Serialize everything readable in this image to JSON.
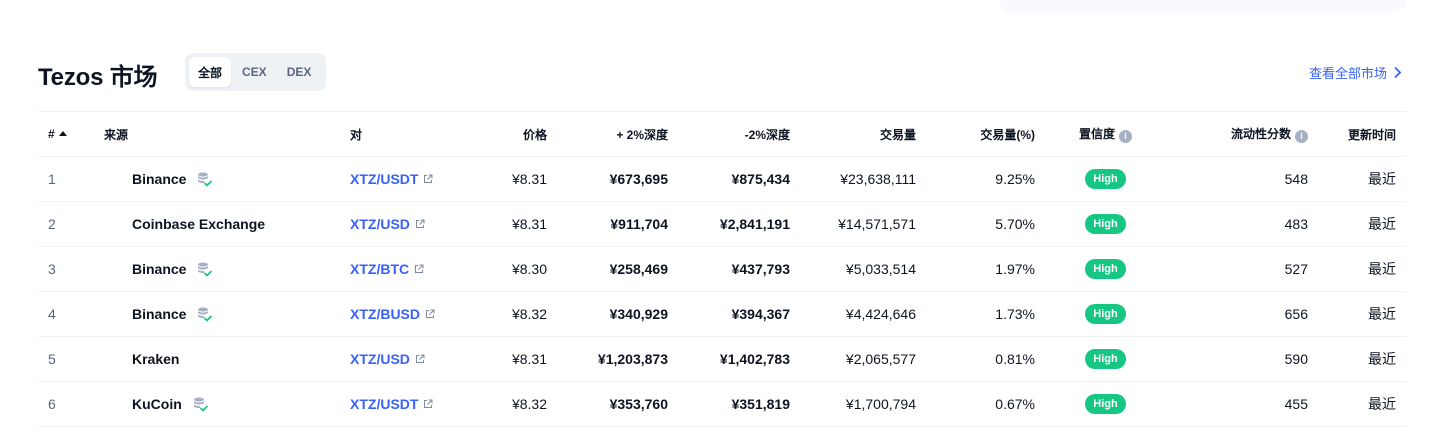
{
  "header": {
    "title": "Tezos 市场",
    "tabs": [
      "全部",
      "CEX",
      "DEX"
    ],
    "active_tab": "全部",
    "view_all": "查看全部市场"
  },
  "table": {
    "columns": [
      "#",
      "来源",
      "对",
      "价格",
      "+ 2%深度",
      "-2%深度",
      "交易量",
      "交易量(%)",
      "置信度",
      "流动性分数",
      "更新时间"
    ],
    "rows": [
      {
        "rank": "1",
        "source": "Binance",
        "certified": true,
        "pair": "XTZ/USDT",
        "price": "¥8.31",
        "depth_plus": "¥673,695",
        "depth_minus": "¥875,434",
        "volume": "¥23,638,111",
        "volume_pct": "9.25%",
        "confidence": "High",
        "liquidity": "548",
        "updated": "最近"
      },
      {
        "rank": "2",
        "source": "Coinbase Exchange",
        "certified": false,
        "pair": "XTZ/USD",
        "price": "¥8.31",
        "depth_plus": "¥911,704",
        "depth_minus": "¥2,841,191",
        "volume": "¥14,571,571",
        "volume_pct": "5.70%",
        "confidence": "High",
        "liquidity": "483",
        "updated": "最近"
      },
      {
        "rank": "3",
        "source": "Binance",
        "certified": true,
        "pair": "XTZ/BTC",
        "price": "¥8.30",
        "depth_plus": "¥258,469",
        "depth_minus": "¥437,793",
        "volume": "¥5,033,514",
        "volume_pct": "1.97%",
        "confidence": "High",
        "liquidity": "527",
        "updated": "最近"
      },
      {
        "rank": "4",
        "source": "Binance",
        "certified": true,
        "pair": "XTZ/BUSD",
        "price": "¥8.32",
        "depth_plus": "¥340,929",
        "depth_minus": "¥394,367",
        "volume": "¥4,424,646",
        "volume_pct": "1.73%",
        "confidence": "High",
        "liquidity": "656",
        "updated": "最近"
      },
      {
        "rank": "5",
        "source": "Kraken",
        "certified": false,
        "pair": "XTZ/USD",
        "price": "¥8.31",
        "depth_plus": "¥1,203,873",
        "depth_minus": "¥1,402,783",
        "volume": "¥2,065,577",
        "volume_pct": "0.81%",
        "confidence": "High",
        "liquidity": "590",
        "updated": "最近"
      },
      {
        "rank": "6",
        "source": "KuCoin",
        "certified": true,
        "pair": "XTZ/USDT",
        "price": "¥8.32",
        "depth_plus": "¥353,760",
        "depth_minus": "¥351,819",
        "volume": "¥1,700,794",
        "volume_pct": "0.67%",
        "confidence": "High",
        "liquidity": "455",
        "updated": "最近"
      }
    ]
  },
  "colors": {
    "accent": "#3861fb",
    "high_badge": "#16c784",
    "muted": "#58667e"
  }
}
